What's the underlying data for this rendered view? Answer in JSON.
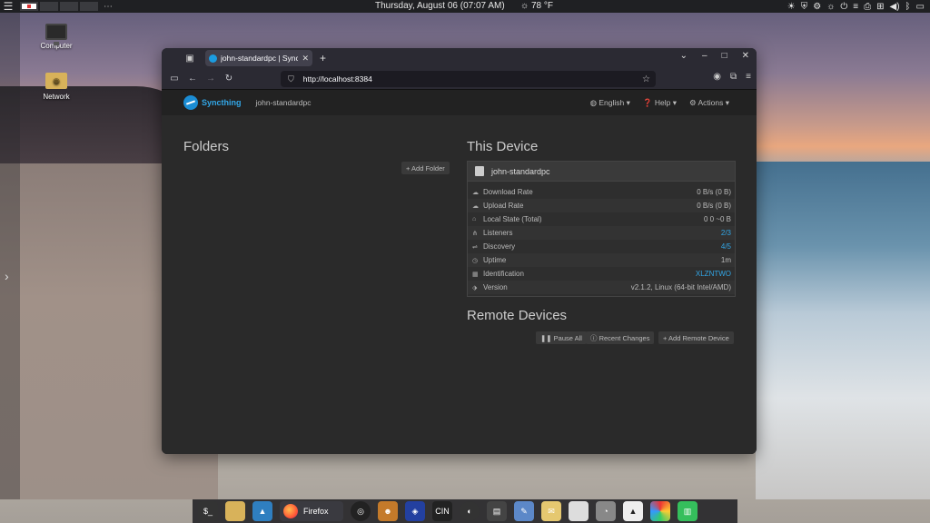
{
  "taskbar": {
    "clock": "Thursday, August 06 (07:07 AM)",
    "weather": "78 °F",
    "tray_icons": [
      "brightness-icon",
      "shield-icon",
      "settings-icon",
      "sun-icon",
      "power-icon",
      "equalizer-icon",
      "print-icon",
      "network-icon",
      "volume-icon",
      "bluetooth-icon",
      "chat-icon"
    ]
  },
  "desktop": {
    "icons": [
      {
        "label": "Computer"
      },
      {
        "label": "Network"
      }
    ]
  },
  "browser": {
    "tab_title": "john-standardpc | Synct",
    "url": "http://localhost:8384"
  },
  "app": {
    "brand": "Syncthing",
    "device_name": "john-standardpc",
    "menu": {
      "language": "English",
      "help": "Help",
      "actions": "Actions"
    },
    "folders_title": "Folders",
    "add_folder": "+ Add Folder",
    "this_device_title": "This Device",
    "this_device_name": "john-standardpc",
    "rows": [
      {
        "label": "Download Rate",
        "value": "0 B/s (0 B)"
      },
      {
        "label": "Upload Rate",
        "value": "0 B/s (0 B)"
      },
      {
        "label": "Local State (Total)",
        "value": "0   0   ~0 B"
      },
      {
        "label": "Listeners",
        "value": "2/3"
      },
      {
        "label": "Discovery",
        "value": "4/5"
      },
      {
        "label": "Uptime",
        "value": "1m"
      },
      {
        "label": "Identification",
        "value": "XLZNTWO"
      },
      {
        "label": "Version",
        "value": "v2.1.2, Linux (64-bit Intel/AMD)"
      }
    ],
    "remote_title": "Remote Devices",
    "pause_all": "Pause All",
    "recent_changes": "Recent Changes",
    "add_remote": "+ Add Remote Device"
  },
  "dock": {
    "firefox_label": "Firefox"
  }
}
